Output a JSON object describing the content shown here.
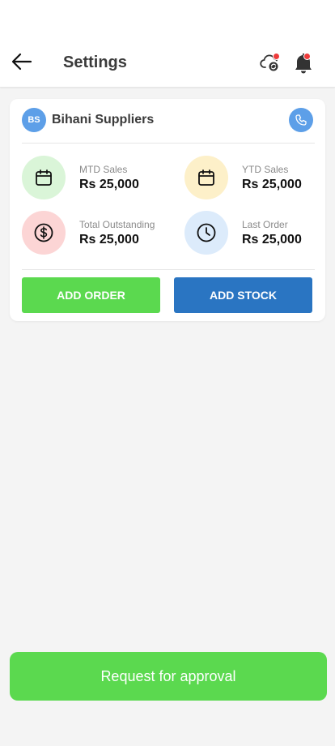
{
  "header": {
    "title": "Settings",
    "back_icon": "arrow-left-icon",
    "sync_icon": "cloud-sync-icon",
    "notification_icon": "bell-icon",
    "badge_color": "#ee3b3b"
  },
  "supplier": {
    "initials": "BS",
    "name": "Bihani Suppliers",
    "phone_icon": "phone-icon",
    "avatar_color": "#5d9fe8"
  },
  "stats": [
    {
      "label": "MTD Sales",
      "value": "Rs 25,000",
      "icon": "calendar-icon",
      "bg": "#daf5d8"
    },
    {
      "label": "YTD Sales",
      "value": "Rs 25,000",
      "icon": "calendar-icon",
      "bg": "#fdf0c9"
    },
    {
      "label": "Total Outstanding",
      "value": "Rs 25,000",
      "icon": "dollar-circle-icon",
      "bg": "#fcd5d5"
    },
    {
      "label": "Last Order",
      "value": "Rs 25,000",
      "icon": "clock-icon",
      "bg": "#dcebfb"
    }
  ],
  "actions": {
    "add_order": "ADD ORDER",
    "add_stock": "ADD STOCK",
    "green": "#5bd94f",
    "blue": "#2a75c2"
  },
  "footer": {
    "approval_label": "Request for approval"
  }
}
